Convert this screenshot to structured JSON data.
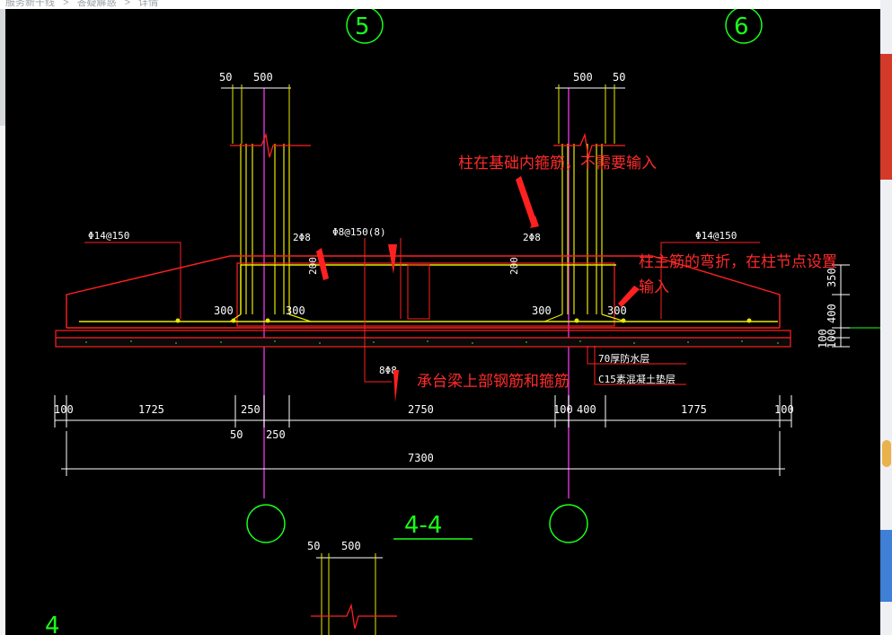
{
  "breadcrumb": [
    "服务新干线",
    ">",
    "答疑解惑",
    ">",
    "详情"
  ],
  "axes": {
    "left": "5",
    "right": "6"
  },
  "section_title": "4-4",
  "corner_mark": "4",
  "rebar_labels": {
    "top_left": "Φ14@150",
    "top_right": "Φ14@150",
    "stirrup_mid": "Φ8@150(8)",
    "left_2phi8": "2Φ8",
    "right_2phi8": "2Φ8",
    "bottom_8phi8": "8Φ8",
    "vert_200_left": "200",
    "vert_200_right": "200"
  },
  "dimensions": {
    "top_left": [
      "50",
      "500"
    ],
    "top_right": [
      "500",
      "50"
    ],
    "bottom_top_small": [
      "50",
      "500"
    ],
    "offsets": [
      "300",
      "300",
      "300",
      "300"
    ],
    "right_vertical": [
      "350",
      "400",
      "100",
      "100"
    ],
    "row1": [
      "100",
      "1725",
      "250",
      "2750",
      "100",
      "400",
      "1775",
      "100"
    ],
    "row1_sub": [
      "50",
      "250"
    ],
    "total": "7300"
  },
  "layer_notes": [
    "70厚防水层",
    "C15素混凝土垫层"
  ],
  "annotations": {
    "stirrup_in_foundation": "柱在基础内箍筋，不需要输入",
    "main_bar_bend": "柱主筋的弯折，在柱节点设置",
    "main_bar_bend_2": "输入",
    "cap_beam": "承台梁上部钢筋和箍筋"
  }
}
